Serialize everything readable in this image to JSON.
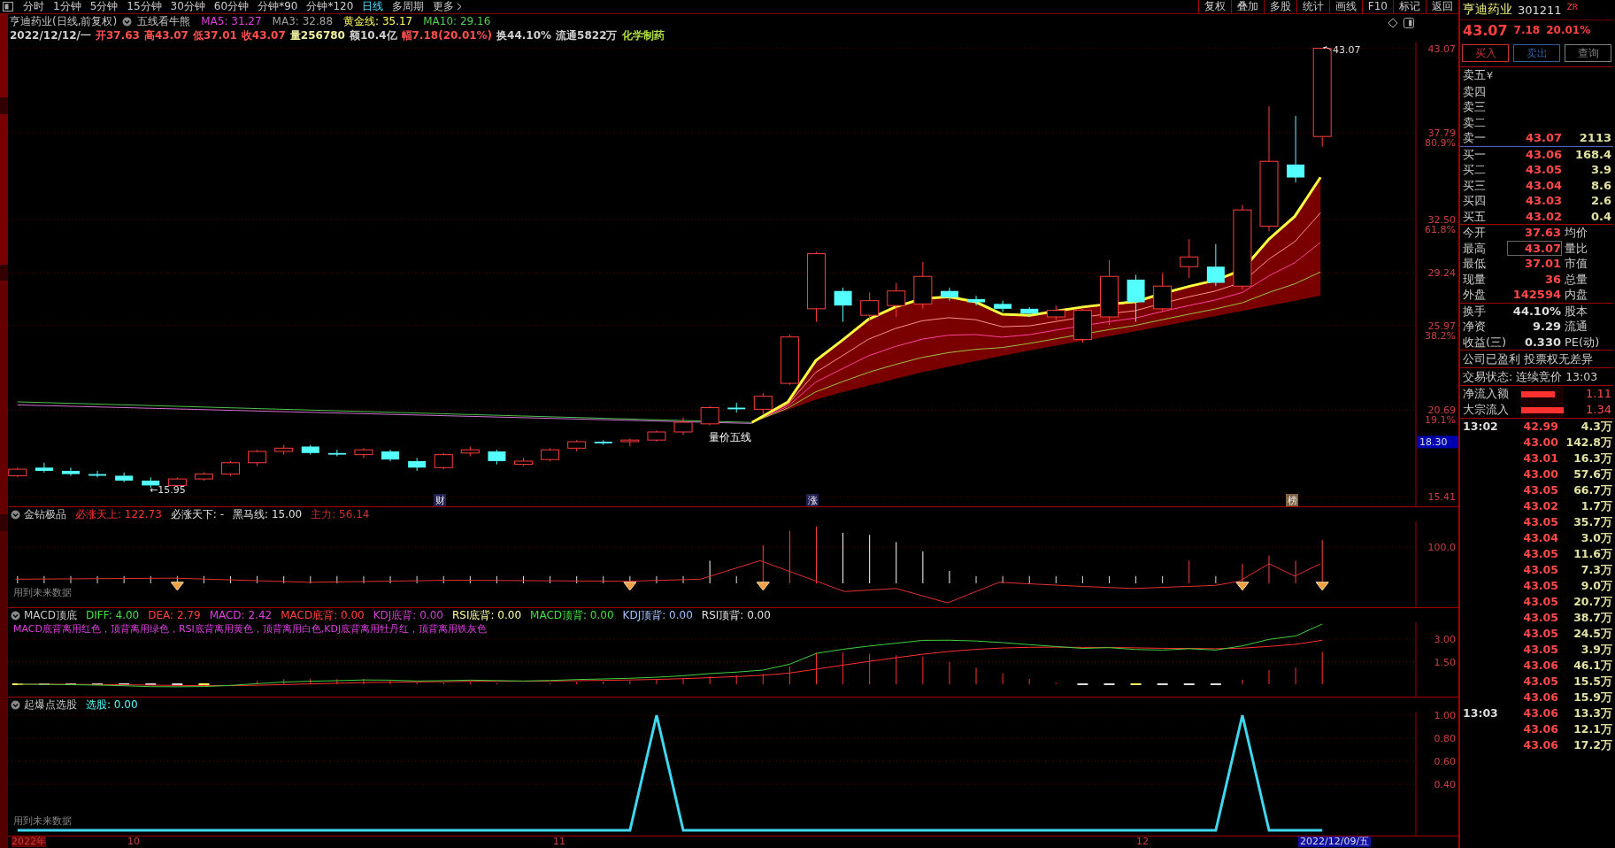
{
  "toolbar": {
    "periods": [
      {
        "label": "分时",
        "selected": false
      },
      {
        "label": "1分钟",
        "selected": false
      },
      {
        "label": "5分钟",
        "selected": false
      },
      {
        "label": "15分钟",
        "selected": false
      },
      {
        "label": "30分钟",
        "selected": false
      },
      {
        "label": "60分钟",
        "selected": false
      },
      {
        "label": "分钟*90",
        "selected": false
      },
      {
        "label": "分钟*120",
        "selected": false
      },
      {
        "label": "日线",
        "selected": true
      },
      {
        "label": "多周期",
        "selected": false
      }
    ],
    "more": "更多",
    "tools": [
      "复权",
      "叠加",
      "多股",
      "统计",
      "画线",
      "F10",
      "标记",
      "返回"
    ]
  },
  "main_chart": {
    "title": "亨迪药业(日线,前复权)",
    "indicator": "五线看牛熊",
    "legend": [
      {
        "text": "MA5: 31.27",
        "color": "#e040e0"
      },
      {
        "text": "MA3: 32.88",
        "color": "#a0a0a0"
      },
      {
        "text": "黄金线: 35.17",
        "color": "#ffff60"
      },
      {
        "text": "MA10: 29.16",
        "color": "#50d050"
      }
    ],
    "bar_info": [
      {
        "text": "2022/12/12/一",
        "color": "#d0d0d0"
      },
      {
        "text": "开37.63",
        "color": "#ff5050"
      },
      {
        "text": "高43.07",
        "color": "#ff5050"
      },
      {
        "text": "低37.01",
        "color": "#ff5050"
      },
      {
        "text": "收43.07",
        "color": "#ff5050"
      },
      {
        "text": "量256780",
        "color": "#f0f0a0"
      },
      {
        "text": "额10.4亿",
        "color": "#d0d0d0"
      },
      {
        "text": "幅7.18(20.01%)",
        "color": "#ff5050"
      },
      {
        "text": "换44.10%",
        "color": "#d0d0d0"
      },
      {
        "text": "流通5822万",
        "color": "#d0d0d0"
      },
      {
        "text": "化学制药",
        "color": "#b0e040"
      }
    ],
    "axis": [
      {
        "price": "43.07"
      },
      {
        "price": "37.79",
        "pct": "80.9%"
      },
      {
        "price": "32.50",
        "pct": "61.8%"
      },
      {
        "price": "29.24"
      },
      {
        "price": "25.97",
        "pct": "38.2%"
      },
      {
        "price": "20.69",
        "pct": "19.1%"
      },
      {
        "price": "15.41"
      }
    ],
    "cursor_price": "18.30",
    "high_label": "43.07",
    "low_label": "←15.95",
    "signal_label": "量价五线",
    "markers": [
      "财",
      "涨",
      "榜"
    ]
  },
  "panels": [
    {
      "kind": "jinzuan",
      "title": "金钻极品",
      "values": [
        {
          "text": "必涨天上: 122.73",
          "color": "#ff3030"
        },
        {
          "text": "必涨天下: -",
          "color": "#e0e0e0"
        },
        {
          "text": "黑马线: 15.00",
          "color": "#e0e0e0"
        },
        {
          "text": "主力: 56.14",
          "color": "#d03030"
        }
      ],
      "note": "用到未来数据",
      "yticks": [
        "100.0"
      ]
    },
    {
      "kind": "macd",
      "title": "MACD顶底",
      "values": [
        {
          "text": "DIFF: 4.00",
          "color": "#40e040"
        },
        {
          "text": "DEA: 2.79",
          "color": "#ff4040"
        },
        {
          "text": "MACD: 2.42",
          "color": "#e040e0"
        },
        {
          "text": "MACD底背: 0.00",
          "color": "#ff4040"
        },
        {
          "text": "KDJ底背: 0.00",
          "color": "#d040d0"
        },
        {
          "text": "RSI底背: 0.00",
          "color": "#ffffa0"
        },
        {
          "text": "MACD顶背: 0.00",
          "color": "#40e040"
        },
        {
          "text": "KDJ顶背: 0.00",
          "color": "#a0c0ff"
        },
        {
          "text": "RSI顶背: 0.00",
          "color": "#e0e0e0"
        }
      ],
      "legend": "MACD底背离用红色，顶背离用绿色，RSI底背离用黄色，顶背离用白色,KDJ底背离用牡丹红，顶背离用铁灰色",
      "yticks": [
        "3.00",
        "1.50"
      ]
    },
    {
      "kind": "signal",
      "title": "起爆点选股",
      "values": [
        {
          "text": "选股: 0.00",
          "color": "#50ffff"
        }
      ],
      "note": "用到未来数据",
      "yticks": [
        "1.00",
        "0.80",
        "0.60",
        "0.40"
      ]
    }
  ],
  "date_axis": {
    "labels": [
      "2022年",
      "10",
      "11",
      "12"
    ],
    "current": "2022/12/09/五"
  },
  "quote": {
    "name": "亨迪药业",
    "code": "301211",
    "tag": "ZR",
    "price": "43.07",
    "change": "7.18",
    "percent": "20.01%",
    "buttons": [
      {
        "label": "买入",
        "color": "#c83232"
      },
      {
        "label": "卖出",
        "color": "#3c5aa0"
      },
      {
        "label": "查询",
        "color": "#808080"
      }
    ],
    "asks": [
      {
        "label": "卖五",
        "unit": "¥"
      },
      {
        "label": "卖四"
      },
      {
        "label": "卖三"
      },
      {
        "label": "卖二"
      },
      {
        "label": "卖一",
        "price": "43.07",
        "volume": "2113"
      }
    ],
    "bids": [
      {
        "label": "买一",
        "price": "43.06",
        "volume": "168.4"
      },
      {
        "label": "买二",
        "price": "43.05",
        "volume": "3.9"
      },
      {
        "label": "买三",
        "price": "43.04",
        "volume": "8.6"
      },
      {
        "label": "买四",
        "price": "43.03",
        "volume": "2.6"
      },
      {
        "label": "买五",
        "price": "43.02",
        "volume": "0.4"
      }
    ],
    "stats": [
      {
        "label": "今开",
        "value": "37.63",
        "label2": "均价",
        "highlighted": false
      },
      {
        "label": "最高",
        "value": "43.07",
        "label2": "量比",
        "highlighted": true
      },
      {
        "label": "最低",
        "value": "37.01",
        "label2": "市值",
        "highlighted": false
      },
      {
        "label": "现量",
        "value": "36",
        "label2": "总量",
        "highlighted": false
      },
      {
        "label": "外盘",
        "value": "142594",
        "label2": "内盘",
        "highlighted": false
      }
    ],
    "fundamentals": [
      {
        "label": "换手",
        "value": "44.10%",
        "label2": "股本"
      },
      {
        "label": "净资",
        "value": "9.29",
        "label2": "流通"
      },
      {
        "label": "收益(三)",
        "value": "0.330",
        "label2": "PE(动)"
      }
    ],
    "notice": "公司已盈利 投票权无差异",
    "status": "交易状态: 连续竞价 13:03",
    "flows": [
      {
        "label": "净流入额",
        "level": 0.8,
        "value": "1.11"
      },
      {
        "label": "大宗流入",
        "level": 1,
        "value": "1.34"
      }
    ],
    "ticks": [
      {
        "time": "13:02",
        "price": "42.99",
        "volume": "4.3万"
      },
      {
        "price": "43.00",
        "volume": "142.8万"
      },
      {
        "price": "43.01",
        "volume": "16.3万"
      },
      {
        "price": "43.00",
        "volume": "57.6万"
      },
      {
        "price": "43.05",
        "volume": "66.7万"
      },
      {
        "price": "43.02",
        "volume": "1.7万"
      },
      {
        "price": "43.05",
        "volume": "35.7万"
      },
      {
        "price": "43.04",
        "volume": "3.0万"
      },
      {
        "price": "43.05",
        "volume": "11.6万"
      },
      {
        "price": "43.05",
        "volume": "7.3万"
      },
      {
        "price": "43.05",
        "volume": "9.0万"
      },
      {
        "price": "43.05",
        "volume": "20.7万"
      },
      {
        "price": "43.05",
        "volume": "38.7万"
      },
      {
        "price": "43.05",
        "volume": "24.5万"
      },
      {
        "price": "43.05",
        "volume": "3.9万"
      },
      {
        "price": "43.06",
        "volume": "46.1万"
      },
      {
        "price": "43.05",
        "volume": "15.5万"
      },
      {
        "price": "43.06",
        "volume": "15.9万"
      },
      {
        "time": "13:03",
        "price": "43.06",
        "volume": "13.3万"
      },
      {
        "price": "43.06",
        "volume": "12.1万"
      },
      {
        "price": "43.06",
        "volume": "17.2万"
      }
    ]
  }
}
